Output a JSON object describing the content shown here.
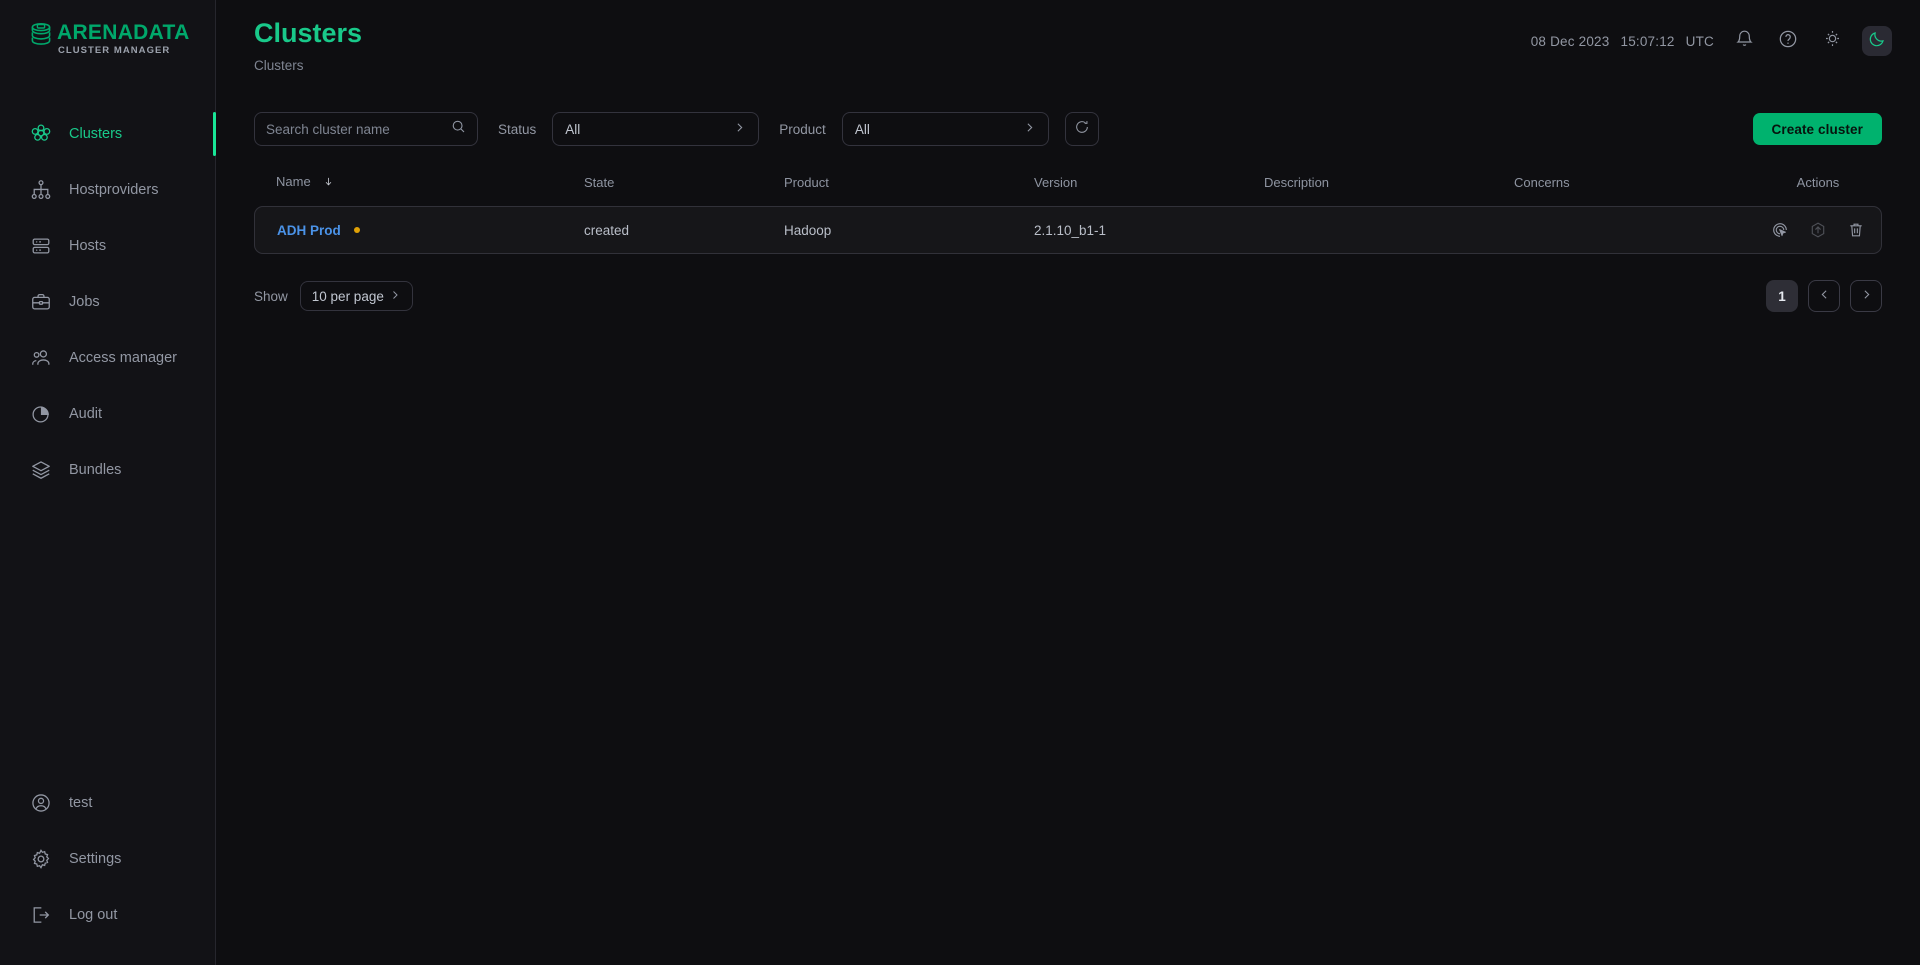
{
  "brand": {
    "name": "ARENADATA",
    "subtitle": "CLUSTER MANAGER",
    "accent": "#00a86b"
  },
  "sidebar": {
    "main_items": [
      {
        "id": "clusters",
        "label": "Clusters",
        "icon": "clusters-icon",
        "active": true
      },
      {
        "id": "hostproviders",
        "label": "Hostproviders",
        "icon": "hostproviders-icon",
        "active": false
      },
      {
        "id": "hosts",
        "label": "Hosts",
        "icon": "hosts-icon",
        "active": false
      },
      {
        "id": "jobs",
        "label": "Jobs",
        "icon": "jobs-icon",
        "active": false
      },
      {
        "id": "access-manager",
        "label": "Access manager",
        "icon": "access-manager-icon",
        "active": false
      },
      {
        "id": "audit",
        "label": "Audit",
        "icon": "audit-icon",
        "active": false
      },
      {
        "id": "bundles",
        "label": "Bundles",
        "icon": "bundles-icon",
        "active": false
      }
    ],
    "bottom_items": [
      {
        "id": "user",
        "label": "test",
        "icon": "user-icon"
      },
      {
        "id": "settings",
        "label": "Settings",
        "icon": "gear-icon"
      },
      {
        "id": "logout",
        "label": "Log out",
        "icon": "logout-icon"
      }
    ]
  },
  "header": {
    "title": "Clusters",
    "breadcrumb": "Clusters",
    "date": "08 Dec 2023",
    "time": "15:07:12",
    "timezone": "UTC",
    "title_color": "#19c98a"
  },
  "filters": {
    "search": {
      "placeholder": "Search cluster name",
      "value": ""
    },
    "status": {
      "label": "Status",
      "value": "All"
    },
    "product": {
      "label": "Product",
      "value": "All"
    },
    "refresh_title": "Refresh",
    "create_button": "Create cluster"
  },
  "table": {
    "columns": [
      {
        "key": "name",
        "label": "Name",
        "sorted": true,
        "sort_dir": "desc"
      },
      {
        "key": "state",
        "label": "State"
      },
      {
        "key": "product",
        "label": "Product"
      },
      {
        "key": "version",
        "label": "Version"
      },
      {
        "key": "description",
        "label": "Description"
      },
      {
        "key": "concerns",
        "label": "Concerns"
      },
      {
        "key": "actions",
        "label": "Actions"
      }
    ],
    "rows": [
      {
        "name": "ADH Prod",
        "name_color": "#4b93e8",
        "status_dot_color": "#e0a106",
        "state": "created",
        "product": "Hadoop",
        "version": "2.1.10_b1-1",
        "description": "",
        "concerns": "",
        "actions": [
          "dynamic-actions-icon",
          "upgrade-icon",
          "delete-icon"
        ]
      }
    ]
  },
  "pagination": {
    "show_label": "Show",
    "per_page": "10 per page",
    "current_page": "1",
    "prev_label": "‹",
    "next_label": "›"
  }
}
